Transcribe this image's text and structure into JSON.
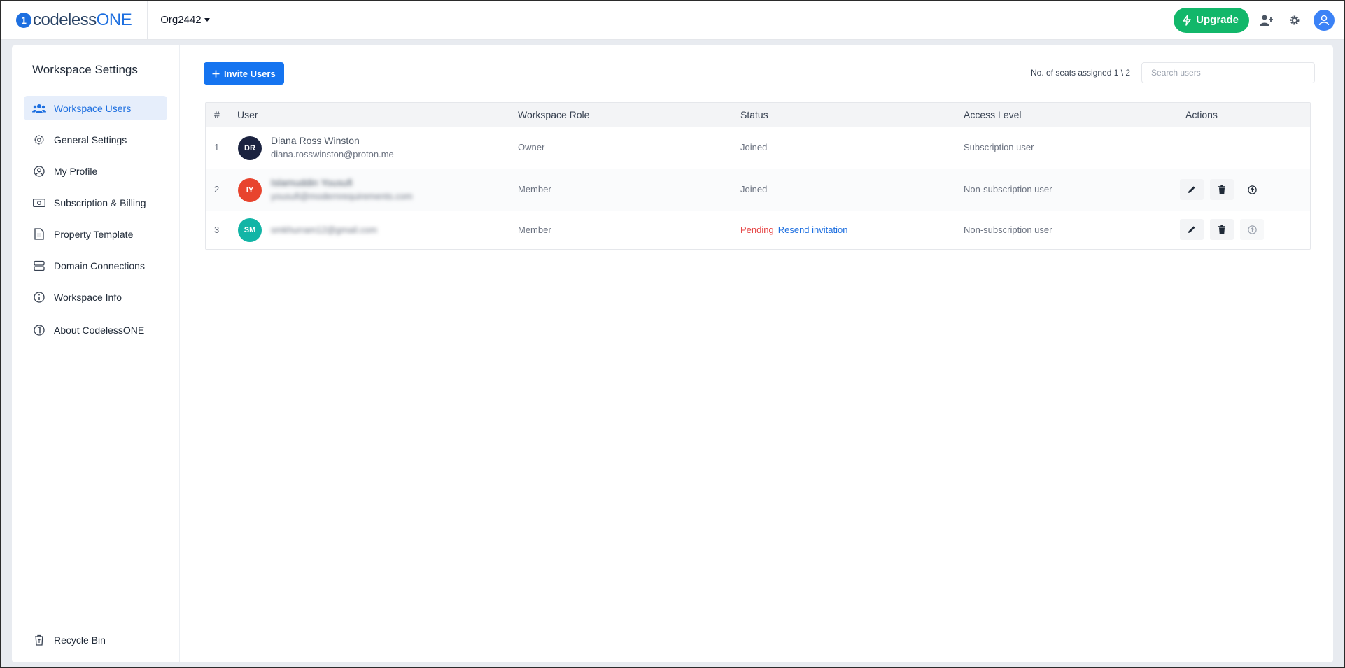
{
  "header": {
    "logo_mark": "1",
    "logo_text_main": "codeless",
    "logo_text_accent": "ONE",
    "org_name": "Org2442",
    "upgrade_label": "Upgrade",
    "colors": {
      "upgrade": "#12b76a",
      "brand": "#1d6fe0"
    }
  },
  "sidebar": {
    "title": "Workspace Settings",
    "items": [
      {
        "label": "Workspace Users",
        "icon": "users-icon",
        "active": true
      },
      {
        "label": "General Settings",
        "icon": "gear-icon"
      },
      {
        "label": "My Profile",
        "icon": "user-circle-icon"
      },
      {
        "label": "Subscription & Billing",
        "icon": "money-icon"
      },
      {
        "label": "Property Template",
        "icon": "document-icon"
      },
      {
        "label": "Domain Connections",
        "icon": "server-icon"
      },
      {
        "label": "Workspace Info",
        "icon": "info-icon"
      },
      {
        "label": "About CodelessONE",
        "icon": "logo-icon"
      }
    ],
    "recycle_bin": {
      "label": "Recycle Bin",
      "icon": "recycle-bin-icon"
    }
  },
  "toolbar": {
    "invite_label": "Invite Users",
    "seats_text": "No. of seats assigned 1 \\ 2",
    "search_placeholder": "Search users"
  },
  "table": {
    "columns": [
      "#",
      "User",
      "Workspace Role",
      "Status",
      "Access Level",
      "Actions"
    ],
    "rows": [
      {
        "num": "1",
        "initials": "DR",
        "avatar_color": "#1b2340",
        "name": "Diana Ross Winston",
        "email": "diana.rosswinston@proton.me",
        "role": "Owner",
        "status": "Joined",
        "access": "Subscription user"
      },
      {
        "num": "2",
        "initials": "IY",
        "avatar_color": "#e8442e",
        "name": "Islamuddin Yousufi",
        "email": "yousufi@modernrequirements.com",
        "role": "Member",
        "status": "Joined",
        "access": "Non-subscription user"
      },
      {
        "num": "3",
        "initials": "SM",
        "avatar_color": "#12b5a6",
        "email": "smkhurram12@gmail.com",
        "role": "Member",
        "status": "Pending",
        "resend": "Resend invitation",
        "access": "Non-subscription user"
      }
    ]
  }
}
